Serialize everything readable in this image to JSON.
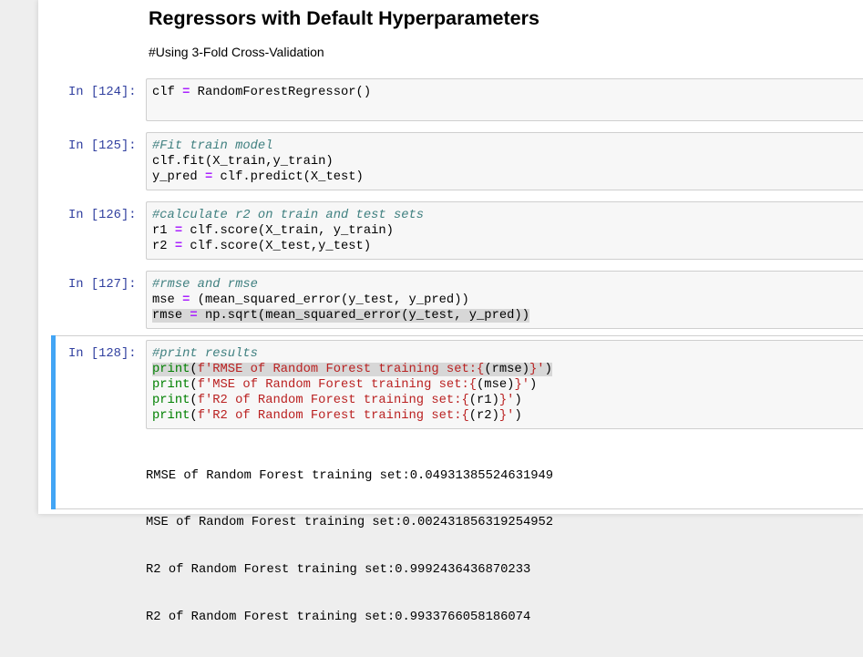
{
  "markdown": {
    "title": "Regressors with Default Hyperparameters",
    "subtitle": "#Using 3-Fold Cross-Validation"
  },
  "cells": [
    {
      "prompt": "In [124]:",
      "lines": [
        [
          {
            "t": "clf "
          },
          {
            "t": "=",
            "c": "op"
          },
          {
            "t": " RandomForestRegressor()"
          }
        ]
      ]
    },
    {
      "prompt": "In [125]:",
      "lines": [
        [
          {
            "t": "#Fit train model",
            "c": "cm"
          }
        ],
        [
          {
            "t": "clf.fit(X_train,y_train)"
          }
        ],
        [
          {
            "t": "y_pred "
          },
          {
            "t": "=",
            "c": "op"
          },
          {
            "t": " clf.predict(X_test)"
          }
        ]
      ]
    },
    {
      "prompt": "In [126]:",
      "lines": [
        [
          {
            "t": "#calculate r2 on train and test sets",
            "c": "cm"
          }
        ],
        [
          {
            "t": "r1 "
          },
          {
            "t": "=",
            "c": "op"
          },
          {
            "t": " clf.score(X_train, y_train)"
          }
        ],
        [
          {
            "t": "r2 "
          },
          {
            "t": "=",
            "c": "op"
          },
          {
            "t": " clf.score(X_test,y_test)"
          }
        ]
      ]
    },
    {
      "prompt": "In [127]:",
      "lines": [
        [
          {
            "t": "#rmse and rmse",
            "c": "cm"
          }
        ],
        [
          {
            "t": "mse "
          },
          {
            "t": "=",
            "c": "op"
          },
          {
            "t": " (mean_squared_error(y_test, y_pred))"
          }
        ],
        [
          {
            "t": "rmse "
          },
          {
            "t": "=",
            "c": "op"
          },
          {
            "t": " np.sqrt(mean_squared_error(y_test, y_pred))"
          }
        ]
      ],
      "highlight_line": 2
    },
    {
      "prompt": "In [128]:",
      "lines": [
        [
          {
            "t": "#print results",
            "c": "cm"
          }
        ],
        [
          {
            "t": "print",
            "c": "bi"
          },
          {
            "t": "("
          },
          {
            "t": "f'RMSE of Random Forest training set:{",
            "c": "st"
          },
          {
            "t": "(rmse)"
          },
          {
            "t": "}'",
            "c": "st"
          },
          {
            "t": ")"
          }
        ],
        [
          {
            "t": "print",
            "c": "bi"
          },
          {
            "t": "("
          },
          {
            "t": "f'MSE of Random Forest training set:{",
            "c": "st"
          },
          {
            "t": "(mse)"
          },
          {
            "t": "}'",
            "c": "st"
          },
          {
            "t": ")"
          }
        ],
        [
          {
            "t": "print",
            "c": "bi"
          },
          {
            "t": "("
          },
          {
            "t": "f'R2 of Random Forest training set:{",
            "c": "st"
          },
          {
            "t": "(r1)"
          },
          {
            "t": "}'",
            "c": "st"
          },
          {
            "t": ")"
          }
        ],
        [
          {
            "t": "print",
            "c": "bi"
          },
          {
            "t": "("
          },
          {
            "t": "f'R2 of Random Forest training set:{",
            "c": "st"
          },
          {
            "t": "(r2)"
          },
          {
            "t": "}'",
            "c": "st"
          },
          {
            "t": ")"
          }
        ]
      ],
      "highlight_line": 1,
      "selected": true
    }
  ],
  "output": [
    "RMSE of Random Forest training set:0.04931385524631949",
    "MSE of Random Forest training set:0.002431856319254952",
    "R2 of Random Forest training set:0.9992436436870233",
    "R2 of Random Forest training set:0.9933766058186074"
  ],
  "colors": {
    "prompt": "#303f9f",
    "comment": "#408080",
    "operator": "#aa22ff",
    "builtin": "#008000",
    "string": "#ba2121",
    "selected_bar": "#42a5f5"
  }
}
